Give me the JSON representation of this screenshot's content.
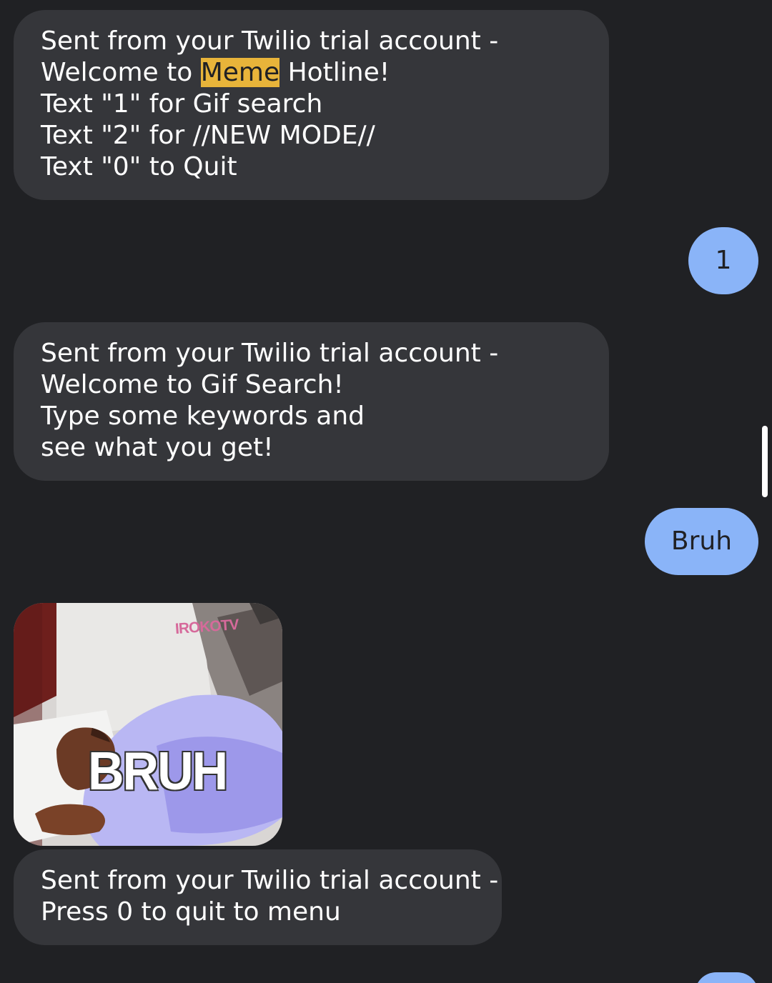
{
  "messages": {
    "msg1": {
      "line1": "Sent from your Twilio trial account -",
      "line2_before": "Welcome to ",
      "line2_highlight": "Meme",
      "line2_after": " Hotline!",
      "line3": "Text \"1\" for Gif search",
      "line4": "Text \"2\" for //NEW MODE//",
      "line5": "Text \"0\" to Quit"
    },
    "reply1": "1",
    "msg3": {
      "line1": "Sent from your Twilio trial account -",
      "line2": "Welcome to Gif Search!",
      "line3": "Type some keywords and",
      "line4": "see what you get!"
    },
    "reply2": "Bruh",
    "gif": {
      "watermark": "IROKOTV",
      "caption": "BRUH"
    },
    "msg5": {
      "line1": "Sent from your Twilio trial account -",
      "line2": "Press 0 to quit to menu"
    },
    "reply3": ""
  },
  "colors": {
    "background": "#202124",
    "incoming_bubble": "#35363a",
    "outgoing_bubble": "#8ab4f8",
    "highlight": "#e8b43a"
  }
}
